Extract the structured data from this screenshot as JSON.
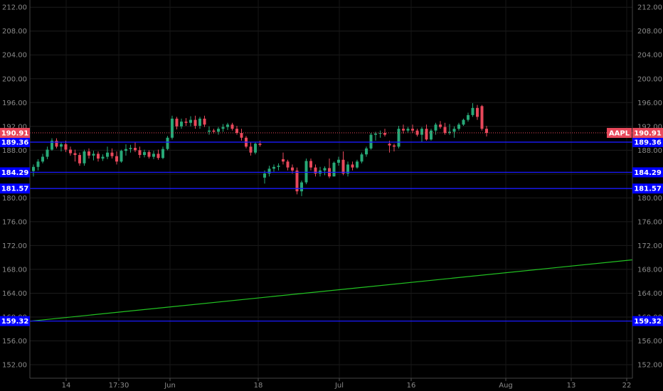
{
  "chart_data": {
    "type": "candlestick",
    "symbol": "AAPL",
    "ylim": [
      150,
      214
    ],
    "y_ticks": [
      152,
      156,
      160,
      164,
      168,
      172,
      176,
      180,
      184,
      188,
      192,
      196,
      200,
      204,
      208,
      212
    ],
    "y_tick_labels": [
      "152.00",
      "156.00",
      "160.00",
      "164.00",
      "168.00",
      "172.00",
      "176.00",
      "180.00",
      "184.00",
      "188.00",
      "192.00",
      "196.00",
      "200.00",
      "204.00",
      "208.00",
      "212.00"
    ],
    "x_tick_labels": [
      "14",
      "17:30",
      "Jun",
      "18",
      "Jul",
      "16",
      "Aug",
      "13",
      "22"
    ],
    "grid": true,
    "last_price": {
      "value": 190.91,
      "label": "190.91",
      "symbol_label": "AAPL"
    },
    "horizontal_levels": [
      {
        "value": 189.36,
        "label": "189.36"
      },
      {
        "value": 184.29,
        "label": "184.29"
      },
      {
        "value": 181.57,
        "label": "181.57"
      },
      {
        "value": 159.32,
        "label": "159.32"
      }
    ],
    "trendline": {
      "start": 159.3,
      "end": 169.6
    },
    "candles": [
      [
        184.5,
        185.6,
        183.6,
        185.2
      ],
      [
        185.2,
        186.5,
        184.6,
        186.1
      ],
      [
        186.1,
        187.4,
        185.8,
        186.9
      ],
      [
        186.9,
        188.6,
        186.5,
        188.1
      ],
      [
        188.1,
        190.0,
        187.9,
        189.6
      ],
      [
        189.6,
        190.0,
        188.3,
        188.6
      ],
      [
        188.6,
        189.4,
        187.8,
        189.0
      ],
      [
        189.0,
        189.6,
        187.7,
        188.1
      ],
      [
        188.1,
        188.6,
        187.1,
        187.5
      ],
      [
        187.5,
        188.1,
        186.1,
        187.2
      ],
      [
        187.2,
        187.6,
        185.4,
        185.8
      ],
      [
        185.8,
        188.1,
        185.4,
        187.8
      ],
      [
        187.8,
        188.3,
        186.6,
        187.1
      ],
      [
        187.1,
        187.9,
        186.3,
        187.4
      ],
      [
        187.4,
        187.8,
        186.1,
        186.6
      ],
      [
        186.6,
        187.3,
        186.2,
        186.9
      ],
      [
        186.9,
        188.6,
        186.5,
        187.6
      ],
      [
        187.6,
        188.3,
        186.6,
        187.0
      ],
      [
        187.0,
        187.8,
        185.6,
        186.1
      ],
      [
        186.1,
        188.1,
        185.9,
        187.9
      ],
      [
        187.9,
        189.0,
        187.1,
        188.2
      ],
      [
        188.2,
        188.9,
        187.6,
        188.4
      ],
      [
        188.4,
        189.4,
        187.7,
        188.0
      ],
      [
        188.0,
        188.6,
        186.7,
        187.2
      ],
      [
        187.2,
        188.1,
        186.8,
        187.7
      ],
      [
        187.7,
        188.0,
        186.6,
        186.9
      ],
      [
        186.9,
        187.9,
        186.5,
        187.4
      ],
      [
        187.4,
        188.1,
        186.4,
        186.7
      ],
      [
        186.7,
        188.6,
        186.5,
        188.2
      ],
      [
        188.2,
        190.4,
        188.0,
        190.1
      ],
      [
        190.1,
        193.8,
        189.8,
        193.3
      ],
      [
        193.3,
        193.6,
        191.5,
        192.0
      ],
      [
        192.0,
        193.3,
        191.6,
        192.8
      ],
      [
        192.8,
        193.4,
        192.1,
        192.6
      ],
      [
        192.6,
        193.7,
        192.0,
        193.1
      ],
      [
        193.1,
        193.8,
        191.6,
        192.1
      ],
      [
        192.1,
        193.6,
        191.6,
        193.3
      ],
      [
        193.3,
        193.8,
        191.9,
        192.3
      ],
      [
        191.1,
        192.0,
        190.6,
        191.3
      ],
      [
        191.3,
        191.6,
        190.8,
        191.1
      ],
      [
        191.1,
        191.9,
        190.6,
        191.6
      ],
      [
        191.6,
        192.4,
        191.1,
        191.9
      ],
      [
        191.9,
        192.6,
        191.4,
        192.3
      ],
      [
        192.3,
        192.6,
        191.3,
        191.6
      ],
      [
        191.6,
        192.1,
        190.6,
        190.9
      ],
      [
        190.9,
        191.6,
        189.6,
        190.1
      ],
      [
        190.1,
        190.4,
        188.3,
        188.6
      ],
      [
        188.6,
        189.3,
        187.1,
        187.6
      ],
      [
        187.6,
        189.3,
        187.3,
        189.1
      ],
      [
        189.1,
        189.6,
        188.6,
        188.9
      ],
      [
        183.4,
        184.6,
        182.4,
        184.1
      ],
      [
        184.1,
        185.4,
        183.6,
        184.9
      ],
      [
        184.9,
        185.6,
        184.4,
        185.2
      ],
      [
        185.2,
        185.8,
        184.6,
        185.4
      ],
      [
        186.5,
        187.6,
        185.6,
        186.1
      ],
      [
        186.1,
        186.4,
        184.6,
        185.1
      ],
      [
        185.1,
        185.6,
        184.1,
        184.6
      ],
      [
        184.6,
        185.1,
        180.6,
        181.1
      ],
      [
        181.1,
        182.9,
        180.3,
        182.6
      ],
      [
        182.6,
        186.6,
        182.3,
        186.2
      ],
      [
        186.2,
        186.6,
        184.6,
        185.1
      ],
      [
        185.1,
        185.6,
        183.6,
        184.1
      ],
      [
        184.1,
        185.2,
        183.6,
        184.6
      ],
      [
        184.6,
        185.3,
        183.8,
        185.0
      ],
      [
        185.0,
        186.6,
        183.3,
        183.6
      ],
      [
        183.6,
        186.1,
        183.6,
        185.9
      ],
      [
        185.9,
        186.9,
        185.4,
        186.4
      ],
      [
        186.4,
        187.8,
        183.8,
        184.1
      ],
      [
        184.1,
        186.1,
        183.6,
        185.6
      ],
      [
        185.6,
        186.1,
        184.6,
        185.1
      ],
      [
        185.1,
        186.4,
        184.9,
        186.1
      ],
      [
        186.1,
        187.6,
        185.8,
        187.3
      ],
      [
        187.3,
        188.6,
        186.9,
        188.3
      ],
      [
        188.3,
        190.9,
        188.1,
        190.6
      ],
      [
        190.6,
        191.1,
        189.6,
        190.8
      ],
      [
        190.8,
        191.3,
        190.1,
        190.9
      ],
      [
        190.9,
        191.6,
        190.3,
        190.6
      ],
      [
        189.1,
        189.6,
        187.6,
        188.8
      ],
      [
        188.8,
        189.1,
        187.8,
        188.6
      ],
      [
        188.6,
        192.1,
        188.3,
        191.6
      ],
      [
        191.6,
        192.3,
        190.8,
        191.3
      ],
      [
        191.3,
        191.9,
        190.9,
        191.6
      ],
      [
        191.6,
        192.3,
        190.9,
        191.3
      ],
      [
        191.3,
        191.6,
        190.3,
        190.6
      ],
      [
        190.6,
        191.9,
        189.3,
        191.6
      ],
      [
        191.6,
        192.3,
        189.6,
        189.8
      ],
      [
        189.8,
        191.6,
        189.6,
        191.3
      ],
      [
        191.3,
        192.6,
        190.6,
        192.3
      ],
      [
        192.3,
        192.9,
        191.6,
        191.9
      ],
      [
        191.9,
        192.6,
        190.6,
        190.9
      ],
      [
        190.9,
        192.4,
        190.6,
        191.1
      ],
      [
        191.1,
        192.0,
        190.1,
        191.6
      ],
      [
        191.6,
        192.6,
        191.3,
        192.3
      ],
      [
        192.3,
        193.3,
        192.1,
        193.1
      ],
      [
        193.1,
        194.3,
        192.8,
        193.9
      ],
      [
        193.9,
        195.9,
        193.6,
        195.1
      ],
      [
        195.1,
        195.6,
        193.1,
        193.6
      ],
      [
        195.4,
        195.6,
        191.3,
        191.6
      ],
      [
        191.6,
        192.1,
        190.3,
        190.9
      ]
    ]
  }
}
